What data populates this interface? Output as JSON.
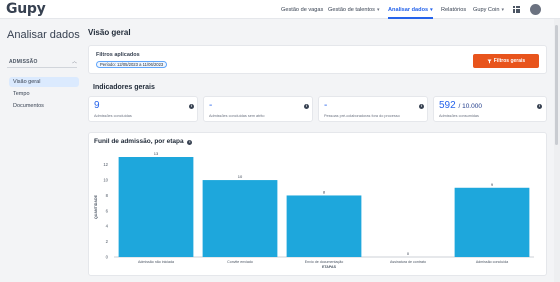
{
  "brand": {
    "logo": "Gupy"
  },
  "nav": {
    "items": [
      {
        "label": "Gestão de vagas",
        "chevron": false,
        "active": false
      },
      {
        "label": "Gestão de talentos",
        "chevron": true,
        "active": false
      },
      {
        "label": "Analisar dados",
        "chevron": true,
        "active": true
      },
      {
        "label": "Relatórios",
        "chevron": false,
        "active": false
      },
      {
        "label": "Gupy Coin",
        "chevron": true,
        "active": false
      }
    ],
    "chevron_glyph": "▾",
    "apps_icon": "grid-icon",
    "avatar_icon": "user-avatar"
  },
  "sidebar": {
    "title": "Analisar dados",
    "section": "ADMISSÃO",
    "section_chevron": "︿",
    "items": [
      {
        "label": "Visão geral",
        "active": true
      },
      {
        "label": "Tempo",
        "active": false
      },
      {
        "label": "Documentos",
        "active": false
      }
    ]
  },
  "main": {
    "title": "Visão geral",
    "filters": {
      "label": "Filtros aplicados",
      "period": "Período: 12/05/2023 a 11/06/2023",
      "button_label": "Filtros gerais",
      "button_icon": "filter-icon"
    },
    "indicators": {
      "title": "Indicadores gerais",
      "cards": [
        {
          "value": "9",
          "total": "",
          "caption": "Admissões concluídas"
        },
        {
          "value": "-",
          "total": "",
          "caption": "Admissões concluídas sem atrito"
        },
        {
          "value": "-",
          "total": "",
          "caption": "Pessoas pré-colaboradoras fora do processo"
        },
        {
          "value": "592",
          "total": "/ 10.000",
          "caption": "Admissões consumidas"
        }
      ],
      "info_glyph": "i"
    },
    "funnel": {
      "title": "Funil de admissão, por etapa"
    }
  },
  "chart_data": {
    "type": "bar",
    "title": "Funil de admissão, por etapa",
    "xlabel": "ETAPAS",
    "ylabel": "QUANTIDADE",
    "categories": [
      "Admissão não iniciada",
      "Convite enviado",
      "Envio de documentação",
      "Assinatura de contrato",
      "Admissão concluída"
    ],
    "values": [
      13,
      10,
      8,
      0,
      9
    ],
    "data_labels": [
      "13",
      "10",
      "8",
      "0",
      "9"
    ],
    "yticks": [
      0,
      2,
      4,
      6,
      8,
      10,
      12
    ],
    "ylim": [
      0,
      13
    ],
    "color": "#1ea7dc",
    "grid": false,
    "legend": "none"
  }
}
